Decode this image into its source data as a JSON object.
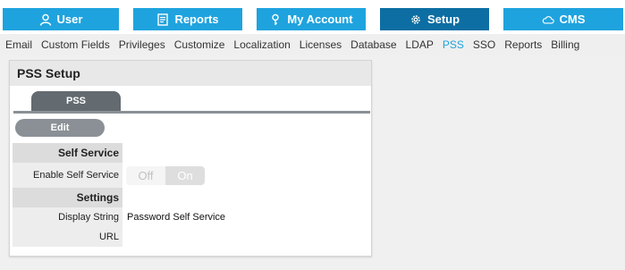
{
  "topnav": {
    "user": "User",
    "reports": "Reports",
    "my_account": "My Account",
    "setup": "Setup",
    "cms": "CMS"
  },
  "subnav": [
    "Email",
    "Custom Fields",
    "Privileges",
    "Customize",
    "Localization",
    "Licenses",
    "Database",
    "LDAP",
    "PSS",
    "SSO",
    "Reports",
    "Billing"
  ],
  "subnav_active": "PSS",
  "panel": {
    "title": "PSS Setup",
    "tab_label": "PSS",
    "edit_label": "Edit",
    "self_service_section": "Self Service",
    "enable_self_service_label": "Enable Self Service",
    "toggle_off": "Off",
    "toggle_on": "On",
    "settings_section": "Settings",
    "display_string_label": "Display String",
    "display_string_value": "Password Self Service",
    "url_label": "URL",
    "url_value": ""
  },
  "colors": {
    "nav_blue": "#1fa3de",
    "nav_active": "#0d6ea3",
    "tab_gray": "#636a70"
  }
}
